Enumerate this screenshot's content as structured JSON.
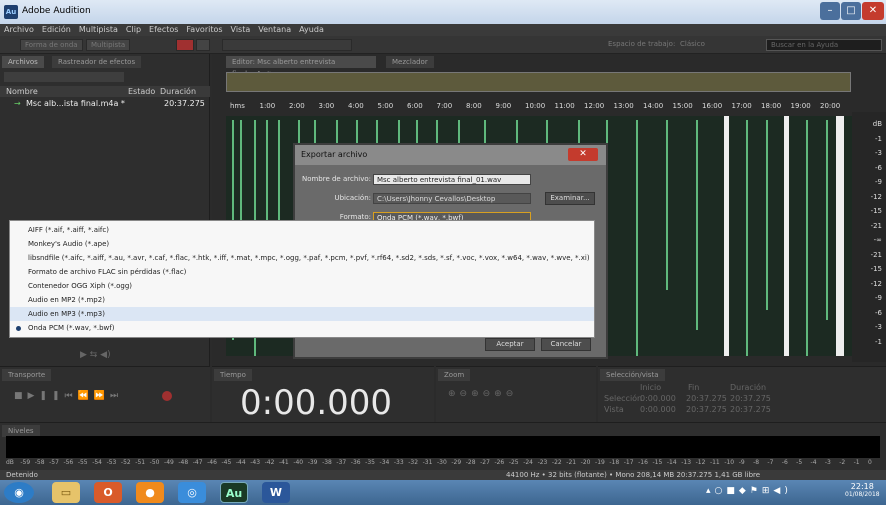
{
  "window": {
    "title": "Adobe Audition",
    "app_icon": "Au"
  },
  "menu": [
    "Archivo",
    "Edición",
    "Multipista",
    "Clip",
    "Efectos",
    "Favoritos",
    "Vista",
    "Ventana",
    "Ayuda"
  ],
  "toolbar": {
    "waveform": "Forma de onda",
    "multitrack": "Multipista",
    "workspace_label": "Espacio de trabajo:",
    "workspace_value": "Clásico",
    "search_placeholder": "Buscar en la Ayuda"
  },
  "files_panel": {
    "tabs": [
      "Archivos",
      "Rastreador de efectos"
    ],
    "columns": {
      "name": "Nombre",
      "state": "Estado",
      "duration": "Duración"
    },
    "items": [
      {
        "name": "Msc alb...ista final.m4a *",
        "duration": "20:37.275"
      }
    ]
  },
  "editor": {
    "tabs": [
      "Editor: Msc alberto entrevista final.m4a *",
      "Mezclador"
    ],
    "ruler": [
      "hms",
      "1:00",
      "2:00",
      "3:00",
      "4:00",
      "5:00",
      "6:00",
      "7:00",
      "8:00",
      "9:00",
      "10:00",
      "11:00",
      "12:00",
      "13:00",
      "14:00",
      "15:00",
      "16:00",
      "17:00",
      "18:00",
      "19:00",
      "20:00"
    ],
    "db_scale": [
      "dB",
      "-1",
      "-3",
      "-6",
      "-9",
      "-12",
      "-15",
      "-21",
      "-∞",
      "-21",
      "-15",
      "-12",
      "-9",
      "-6",
      "-3",
      "-1"
    ]
  },
  "dialog": {
    "title": "Exportar archivo",
    "filename_label": "Nombre de archivo:",
    "filename_value": "Msc alberto entrevista final_01.wav",
    "location_label": "Ubicación:",
    "location_value": "C:\\Users\\Jhonny Cevallos\\Desktop",
    "browse_button": "Examinar...",
    "format_label": "Formato:",
    "format_value": "Onda PCM (*.wav, *.bwf)",
    "ok_button": "Aceptar",
    "cancel_button": "Cancelar"
  },
  "format_options": [
    "AIFF (*.aif, *.aiff, *.aifc)",
    "Monkey's Audio (*.ape)",
    "libsndfile (*.aifc, *.aiff, *.au, *.avr, *.caf, *.flac, *.htk, *.iff, *.mat, *.mpc, *.ogg, *.paf, *.pcm, *.pvf, *.rf64, *.sd2, *.sds, *.sf, *.voc, *.vox, *.w64, *.wav, *.wve, *.xi)",
    "Formato de archivo FLAC sin pérdidas (*.flac)",
    "Contenedor OGG Xiph (*.ogg)",
    "Audio en MP2 (*.mp2)",
    "Audio en MP3 (*.mp3)",
    "Onda PCM (*.wav, *.bwf)"
  ],
  "bottom": {
    "transport_tab": "Transporte",
    "time_tab": "Tiempo",
    "zoom_tab": "Zoom",
    "selection_tab": "Selección/vista",
    "time_display": "0:00.000",
    "sel_headers": [
      "Inicio",
      "Fin",
      "Duración"
    ],
    "sel_rows": [
      {
        "label": "Selección",
        "values": [
          "0:00.000",
          "20:37.275",
          "20:37.275"
        ]
      },
      {
        "label": "Vista",
        "values": [
          "0:00.000",
          "20:37.275",
          "20:37.275"
        ]
      }
    ],
    "levels_tab": "Niveles",
    "meter_scale": [
      "dB",
      "-59",
      "-58",
      "-57",
      "-56",
      "-55",
      "-54",
      "-53",
      "-52",
      "-51",
      "-50",
      "-49",
      "-48",
      "-47",
      "-46",
      "-45",
      "-44",
      "-43",
      "-42",
      "-41",
      "-40",
      "-39",
      "-38",
      "-37",
      "-36",
      "-35",
      "-34",
      "-33",
      "-32",
      "-31",
      "-30",
      "-29",
      "-28",
      "-27",
      "-26",
      "-25",
      "-24",
      "-23",
      "-22",
      "-21",
      "-20",
      "-19",
      "-18",
      "-17",
      "-16",
      "-15",
      "-14",
      "-13",
      "-12",
      "-11",
      "-10",
      "-9",
      "-8",
      "-7",
      "-6",
      "-5",
      "-4",
      "-3",
      "-2",
      "-1",
      "0"
    ]
  },
  "status": {
    "left": "Detenido",
    "right": "44100 Hz • 32 bits (flotante) • Mono   208,14 MB   20:37.275   1,41 GB libre"
  },
  "taskbar": {
    "time": "22:18",
    "date": "01/08/2018"
  },
  "colors": {
    "waveform": "#5fb87c",
    "dialog_close": "#c43b2d",
    "taskbar": "#3d6690",
    "time_display": "#e8e8e8"
  }
}
